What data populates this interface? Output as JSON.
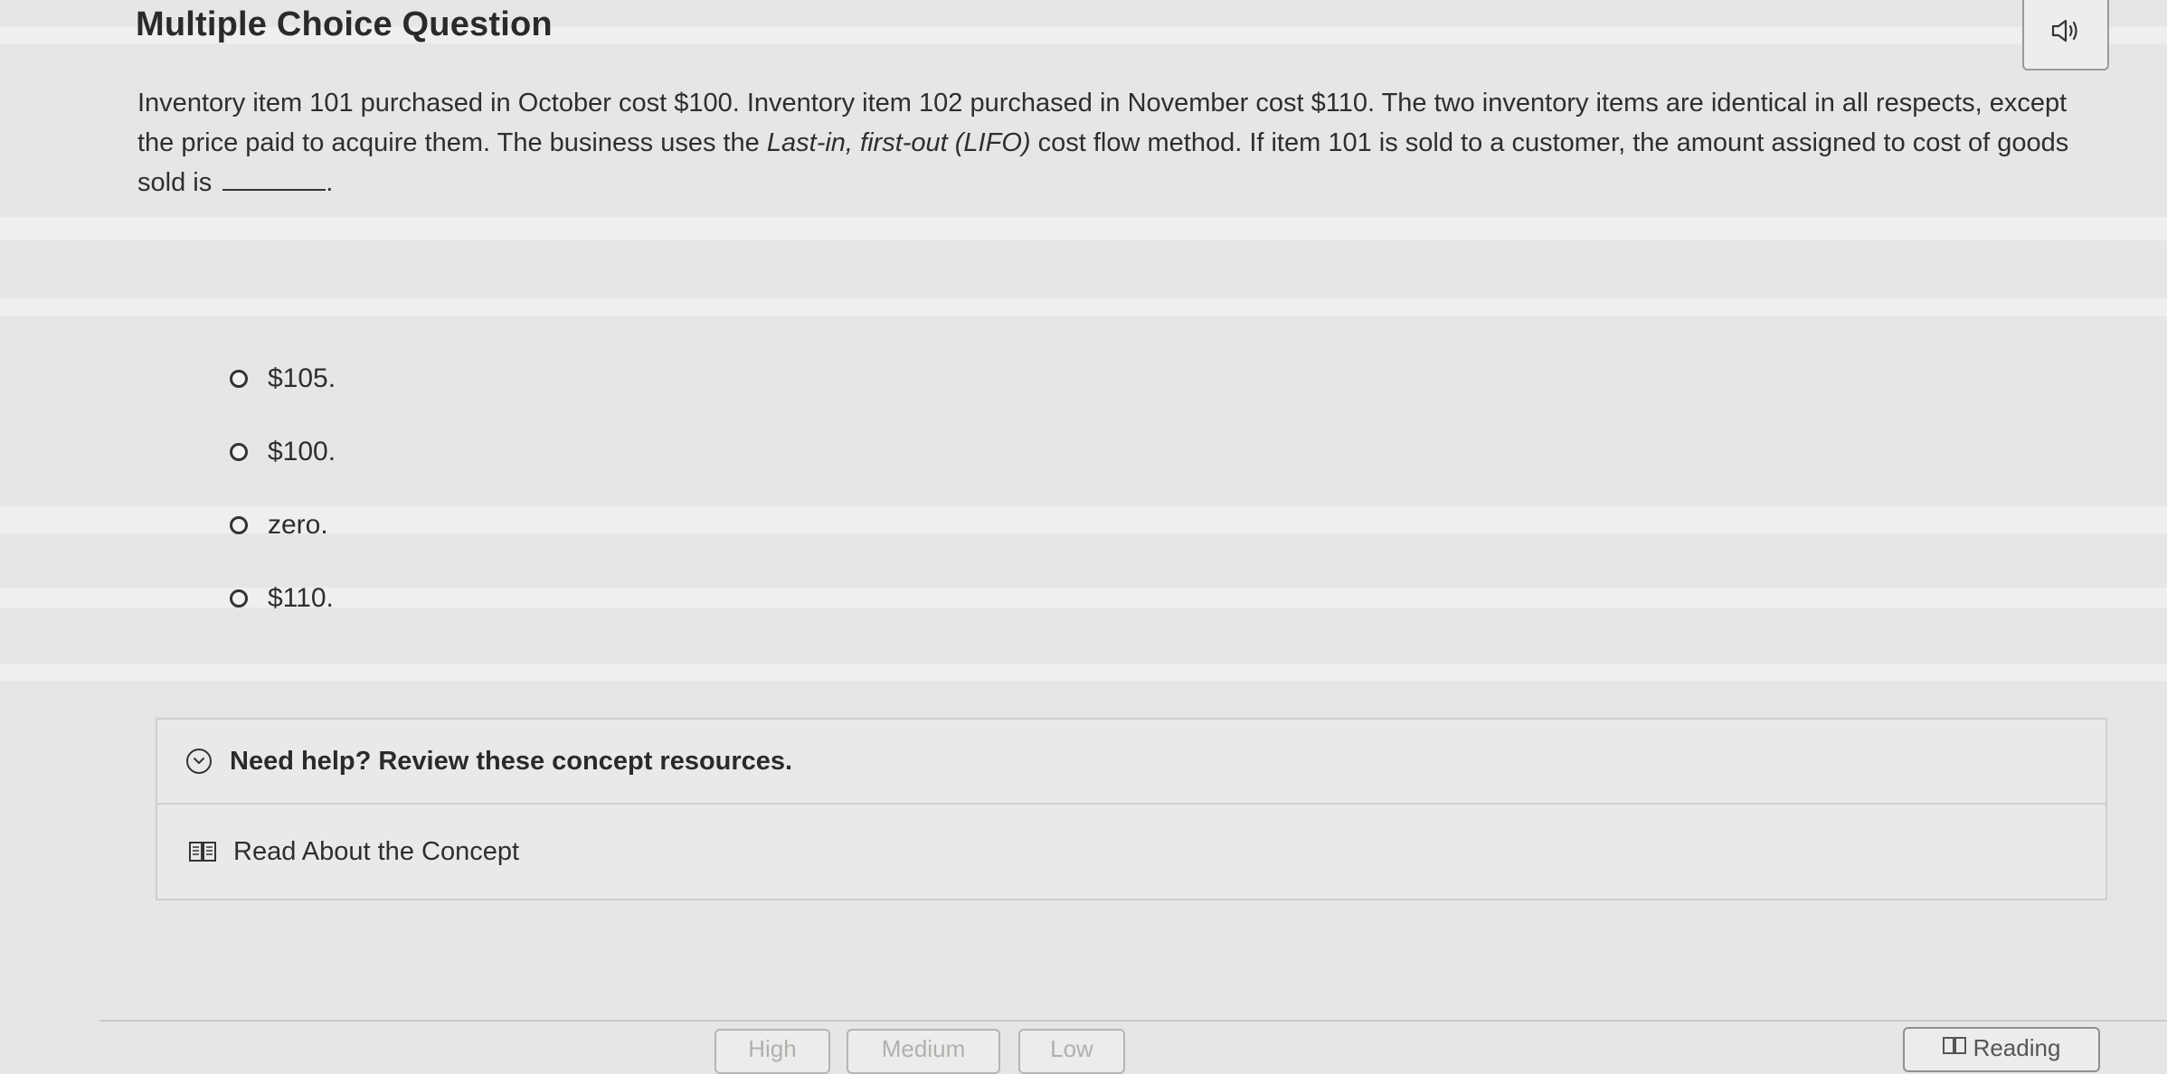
{
  "header": {
    "title": "Multiple Choice Question"
  },
  "question": {
    "part1": "Inventory item 101 purchased in October cost $100. Inventory item 102 purchased in November cost $110. The two inventory items are identical in all respects, except the price paid to acquire them. The business uses the ",
    "emphasis": "Last-in, first-out (LIFO)",
    "part2": " cost flow method. If item 101 is sold to a customer, the amount assigned to cost of goods sold is ",
    "part3": "."
  },
  "options": [
    {
      "label": "$105."
    },
    {
      "label": "$100."
    },
    {
      "label": "zero."
    },
    {
      "label": "$110."
    }
  ],
  "help": {
    "title": "Need help? Review these concept resources.",
    "link_label": "Read About the Concept"
  },
  "confidence": {
    "high": "High",
    "medium": "Medium",
    "low": "Low"
  },
  "reading": {
    "label": "Reading"
  },
  "icons": {
    "audio": "speaker-icon",
    "help_toggle": "chevron-down-circle-icon",
    "concept": "book-icon"
  }
}
